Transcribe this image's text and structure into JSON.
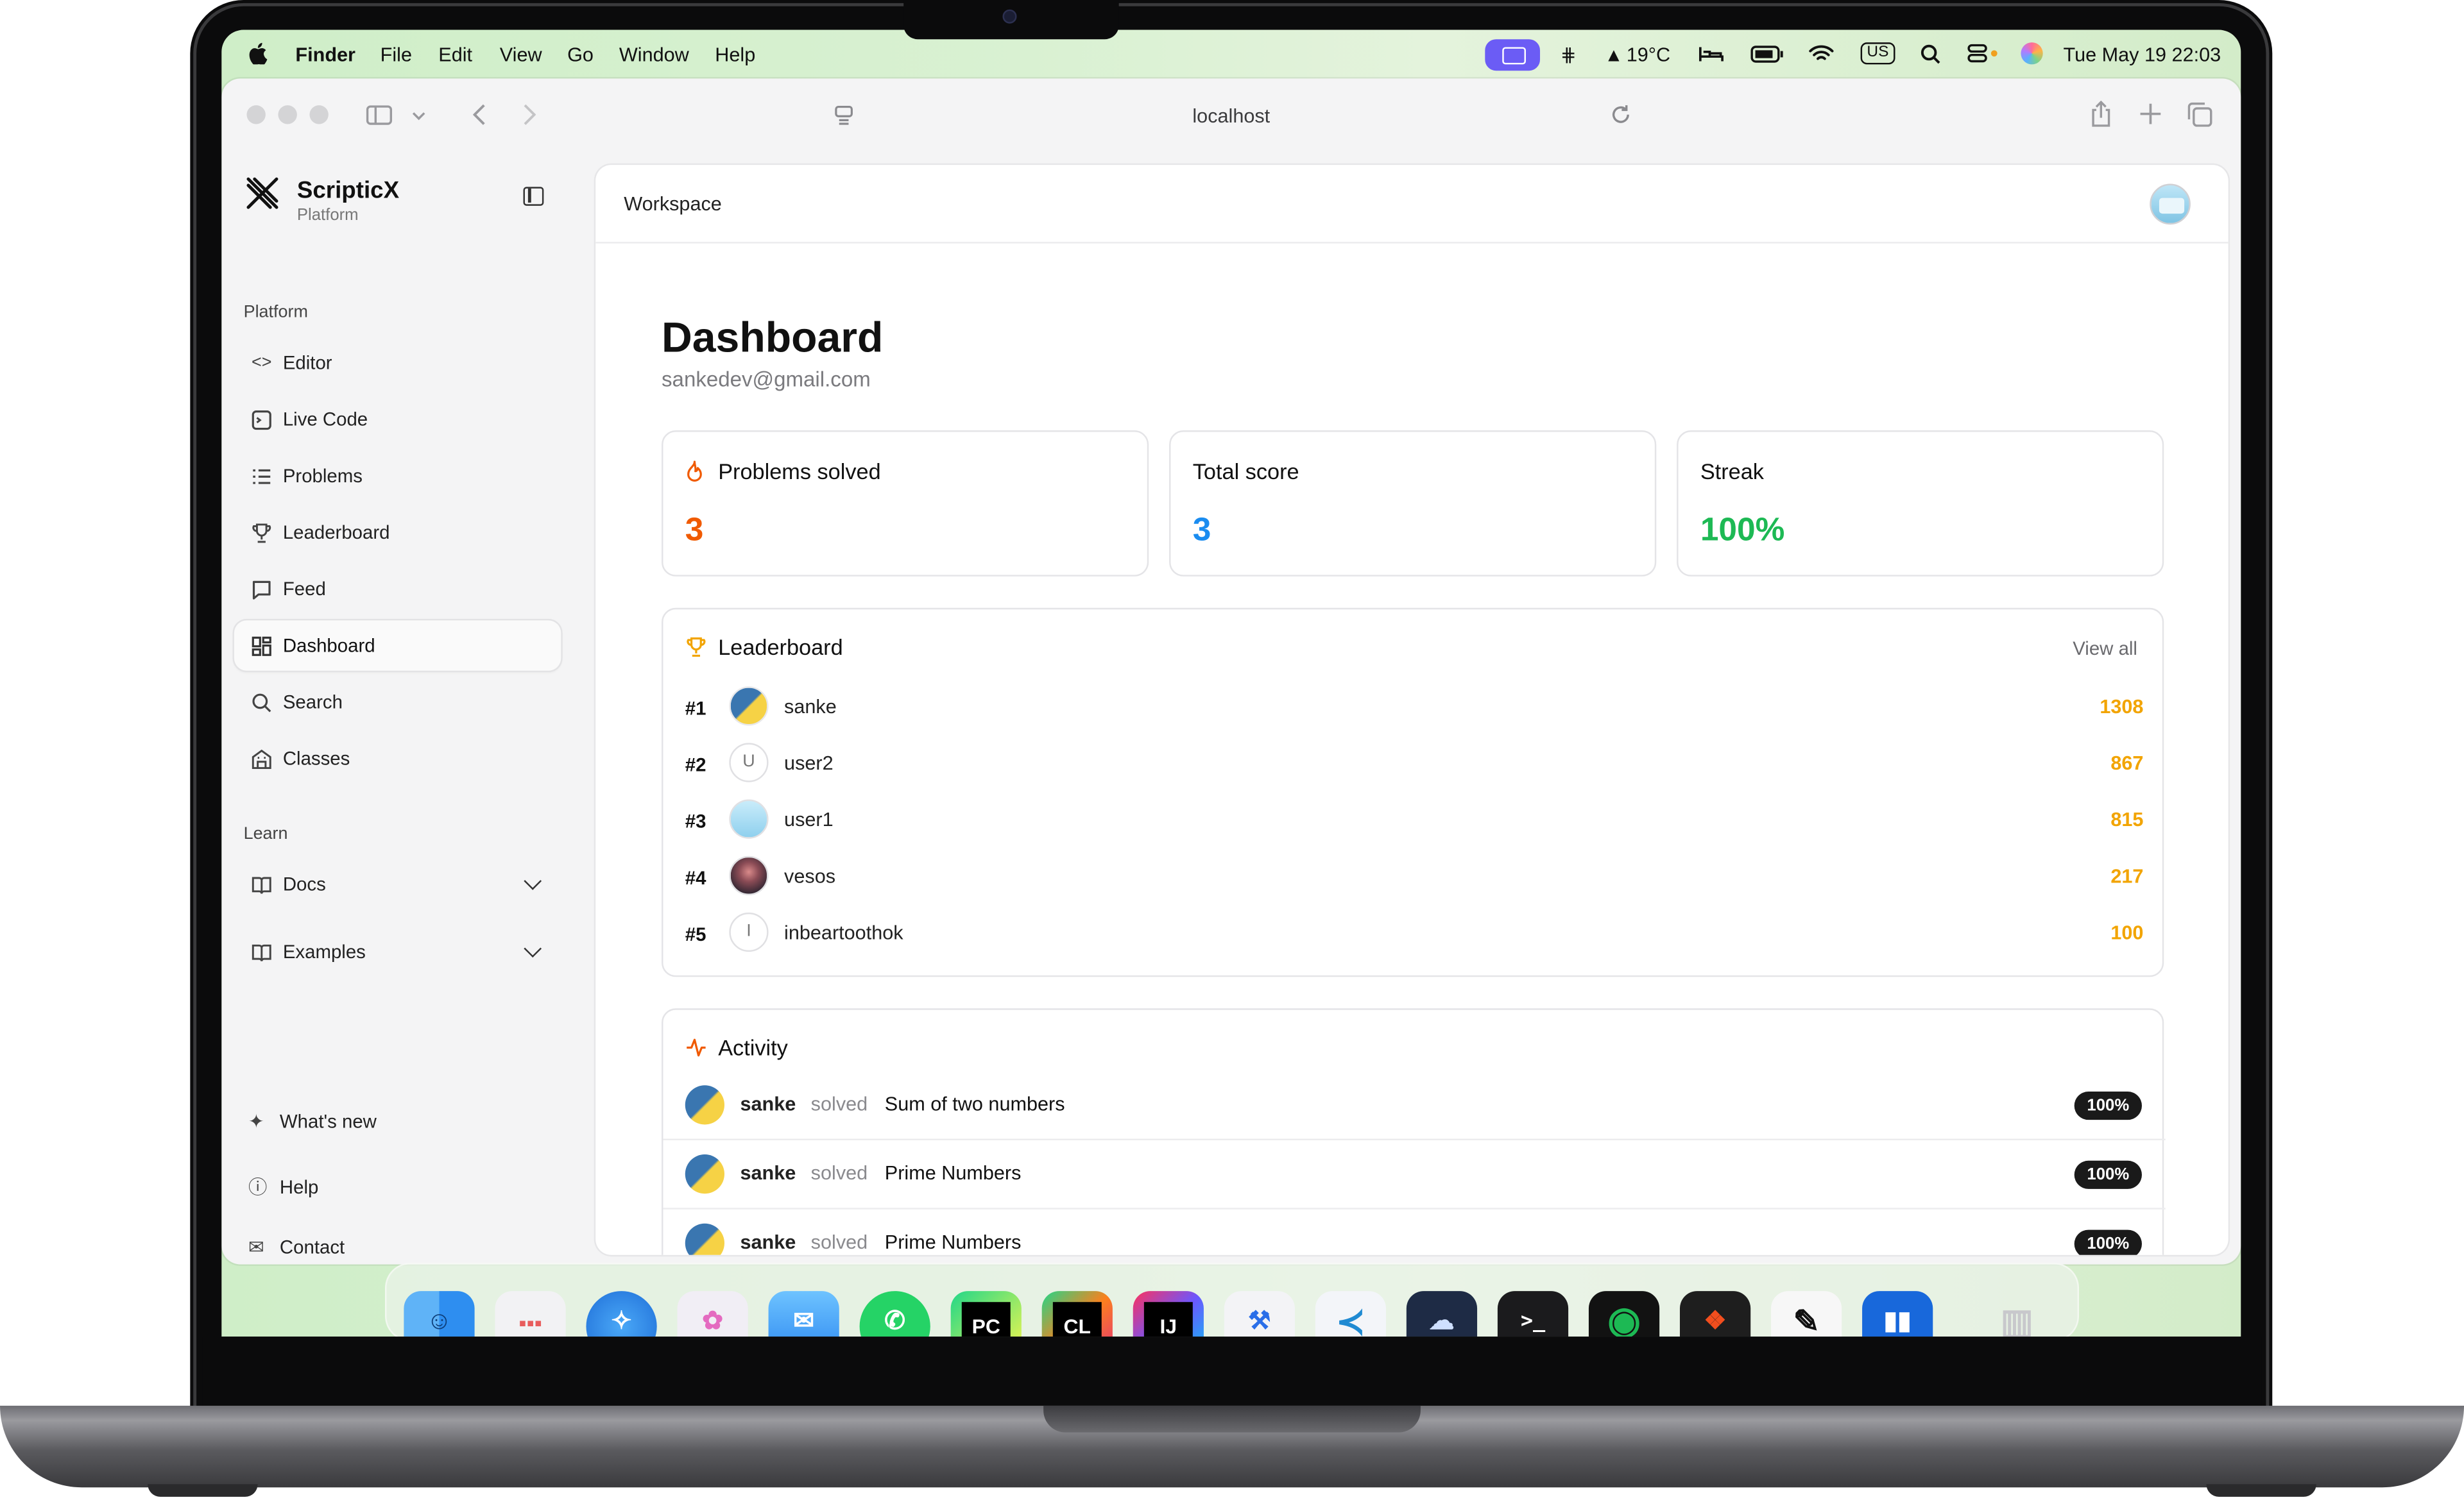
{
  "menubar": {
    "apple_icon": "apple-icon",
    "app_name": "Finder",
    "menus": [
      "File",
      "Edit",
      "View",
      "Go",
      "Window",
      "Help"
    ],
    "weather": "19°C",
    "input_source": "US",
    "datetime": "Tue May 19  22:03"
  },
  "browser": {
    "url": "localhost"
  },
  "sidebar": {
    "brand": "ScripticX",
    "brand_sub": "Platform",
    "section_platform": "Platform",
    "items": [
      {
        "label": "Editor",
        "icon": "code-icon"
      },
      {
        "label": "Live Code",
        "icon": "terminal-icon"
      },
      {
        "label": "Problems",
        "icon": "list-icon"
      },
      {
        "label": "Leaderboard",
        "icon": "trophy-icon"
      },
      {
        "label": "Feed",
        "icon": "message-icon"
      },
      {
        "label": "Dashboard",
        "icon": "grid-icon",
        "active": true
      },
      {
        "label": "Search",
        "icon": "search-icon"
      },
      {
        "label": "Classes",
        "icon": "building-icon"
      }
    ],
    "section_learn": "Learn",
    "learn": [
      {
        "label": "Docs",
        "icon": "book-icon"
      },
      {
        "label": "Examples",
        "icon": "book-icon"
      }
    ],
    "bottom": [
      {
        "label": "What's new",
        "icon": "sparkles-icon"
      },
      {
        "label": "Help",
        "icon": "help-circle-icon"
      },
      {
        "label": "Contact",
        "icon": "mail-icon"
      }
    ]
  },
  "main": {
    "breadcrumb": "Workspace",
    "title": "Dashboard",
    "email": "sankedev@gmail.com",
    "stats": [
      {
        "label": "Problems solved",
        "value": "3",
        "color": "#f05a00"
      },
      {
        "label": "Total score",
        "value": "3",
        "color": "#1a8cf0"
      },
      {
        "label": "Streak",
        "value": "100%",
        "color": "#1db954"
      }
    ],
    "leaderboard": {
      "title": "Leaderboard",
      "view_all": "View all",
      "rows": [
        {
          "rank": "#1",
          "name": "sanke",
          "score": "1308",
          "avatar": "python",
          "initial": ""
        },
        {
          "rank": "#2",
          "name": "user2",
          "score": "867",
          "avatar": "initial",
          "initial": "U"
        },
        {
          "rank": "#3",
          "name": "user1",
          "score": "815",
          "avatar": "cake",
          "initial": ""
        },
        {
          "rank": "#4",
          "name": "vesos",
          "score": "217",
          "avatar": "photo",
          "initial": ""
        },
        {
          "rank": "#5",
          "name": "inbeartoothok",
          "score": "100",
          "avatar": "initial",
          "initial": "I"
        }
      ]
    },
    "activity": {
      "title": "Activity",
      "rows": [
        {
          "user": "sanke",
          "verb": "solved",
          "problem": "Sum of two numbers",
          "badge": "100%"
        },
        {
          "user": "sanke",
          "verb": "solved",
          "problem": "Prime Numbers",
          "badge": "100%"
        },
        {
          "user": "sanke",
          "verb": "solved",
          "problem": "Prime Numbers",
          "badge": "100%"
        }
      ]
    }
  },
  "dock": {
    "apps": [
      "Finder",
      "Launchpad",
      "Safari",
      "Photos",
      "Mail",
      "WhatsApp",
      "PC",
      "CL",
      "IJ",
      "Xcode Instruments",
      "Visual Studio Code",
      "Cloud",
      "Terminal",
      "Spotify",
      "Figma",
      "Pen",
      "Trello",
      "Trash"
    ]
  }
}
